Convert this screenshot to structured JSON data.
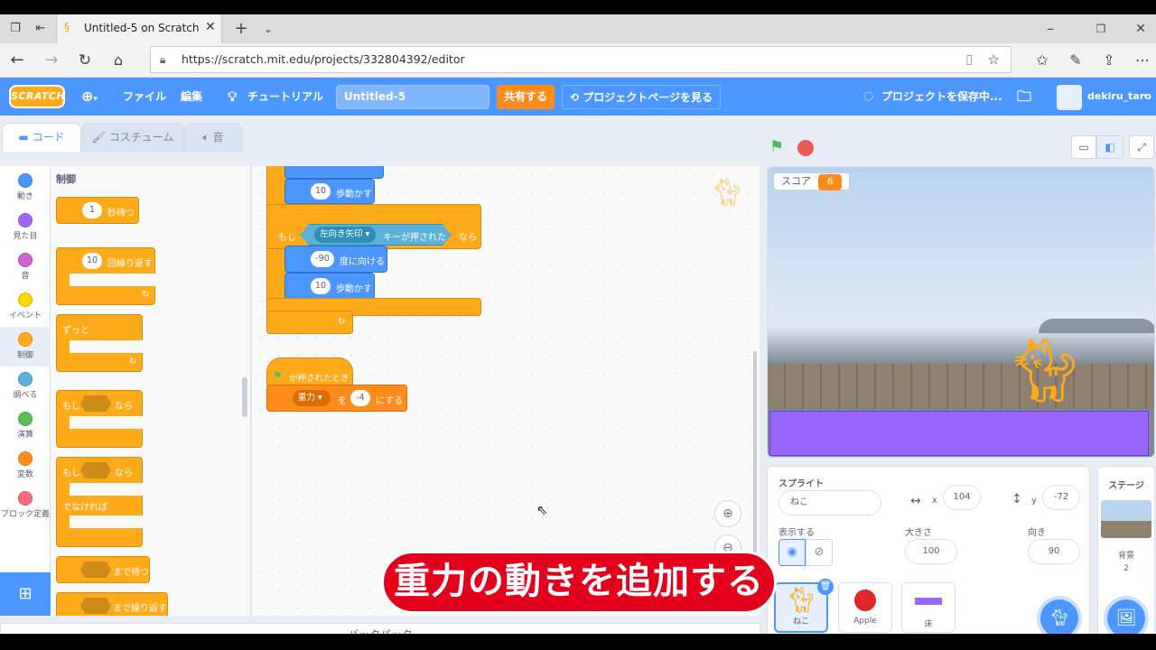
{
  "browser": {
    "tab_title": "Untitled-5 on Scratch",
    "url": "https://scratch.mit.edu/projects/332804392/editor"
  },
  "menubar": {
    "logo": "SCRATCH",
    "file": "ファイル",
    "edit": "編集",
    "tutorial": "チュートリアル",
    "project_title": "Untitled-5",
    "share": "共有する",
    "see_project_page": "プロジェクトページを見る",
    "saving": "プロジェクトを保存中...",
    "username": "dekiru_taro"
  },
  "editor_tabs": {
    "code": "コード",
    "costumes": "コスチューム",
    "sounds": "音"
  },
  "categories": [
    {
      "label": "動き",
      "color": "#4c97ff"
    },
    {
      "label": "見た目",
      "color": "#9966ff"
    },
    {
      "label": "音",
      "color": "#cf63cf"
    },
    {
      "label": "イベント",
      "color": "#ffd500"
    },
    {
      "label": "制御",
      "color": "#ffab19"
    },
    {
      "label": "調べる",
      "color": "#5cb1d6"
    },
    {
      "label": "演算",
      "color": "#59c059"
    },
    {
      "label": "変数",
      "color": "#ff8c1a"
    },
    {
      "label": "ブロック定義",
      "color": "#ff6680"
    }
  ],
  "palette": {
    "heading": "制御",
    "wait_value": "1",
    "wait_label": "秒待つ",
    "repeat_value": "10",
    "repeat_label": "回繰り返す",
    "forever": "ずっと",
    "if_label": "もし",
    "then_label": "なら",
    "else_label": "でなければ",
    "wait_until": "まで待つ",
    "repeat_until": "まで繰り返す"
  },
  "script": {
    "move1_value": "10",
    "move_label": "歩動かす",
    "if_label": "もし",
    "key_option": "左向き矢印",
    "key_pressed": "キーが押された",
    "then_label": "なら",
    "point_value": "-90",
    "point_label": "度に向ける",
    "move2_value": "10",
    "hat_label": "が押されたとき",
    "set_var": "重力",
    "set_to": "を",
    "set_value": "-4",
    "set_label": "にする"
  },
  "backpack": "バックパック",
  "stage": {
    "monitor_label": "スコア",
    "monitor_value": "6"
  },
  "sprite_info": {
    "sprite_label": "スプライト",
    "sprite_name": "ねこ",
    "x_label": "x",
    "x_value": "104",
    "y_label": "y",
    "y_value": "-72",
    "show_label": "表示する",
    "size_label": "大きさ",
    "size_value": "100",
    "direction_label": "向き",
    "direction_value": "90"
  },
  "sprites": [
    {
      "name": "ねこ",
      "selected": true
    },
    {
      "name": "Apple",
      "selected": false
    },
    {
      "name": "床",
      "selected": false
    }
  ],
  "stage_panel": {
    "title": "ステージ",
    "backdrops_label": "背景",
    "backdrops_count": "2"
  },
  "caption": "重力の動きを追加する"
}
